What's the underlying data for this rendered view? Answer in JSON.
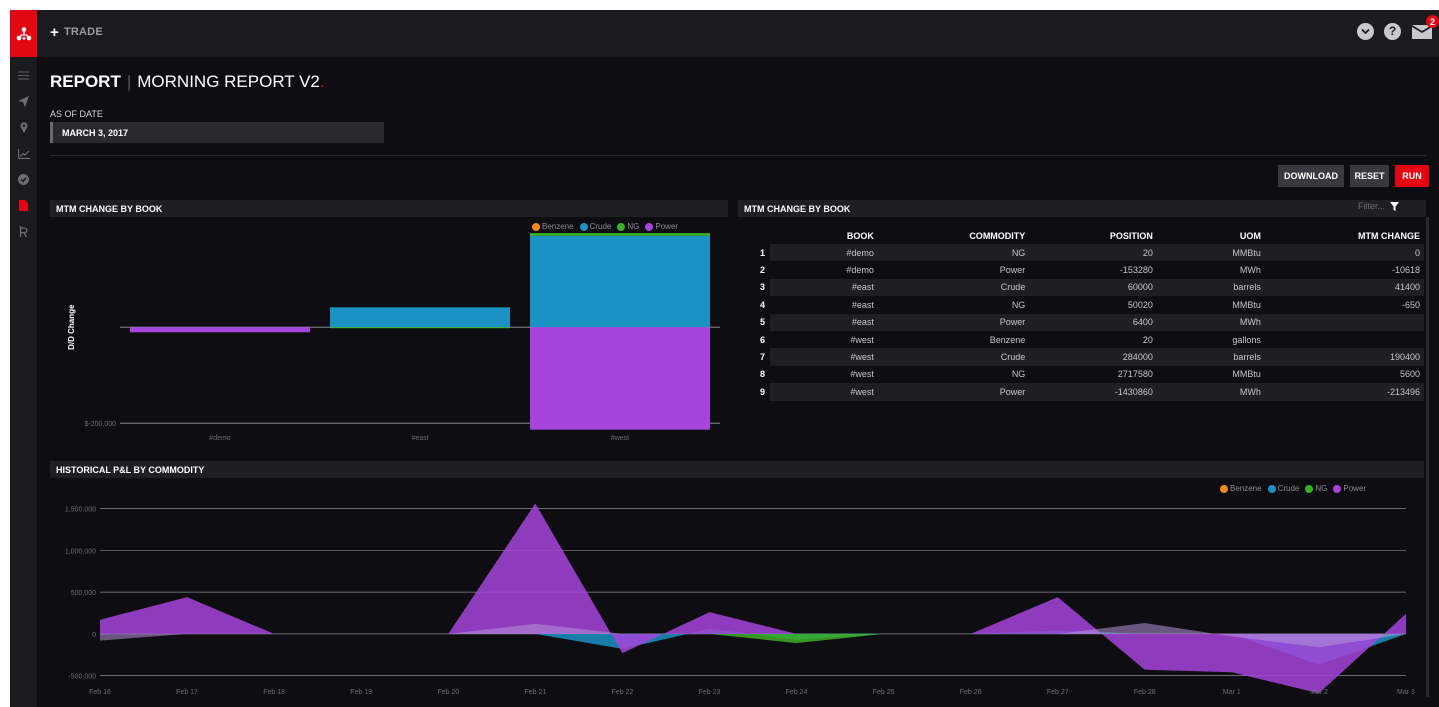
{
  "topbar": {
    "trade_label": "TRADE",
    "mail_count": "2"
  },
  "header": {
    "title_bold": "REPORT",
    "title_name": "MORNING REPORT V2",
    "title_dot": ".",
    "as_of_label": "AS OF DATE",
    "as_of_value": "MARCH 3, 2017"
  },
  "buttons": {
    "download": "DOWNLOAD",
    "reset": "RESET",
    "run": "RUN"
  },
  "panels": {
    "bar_title": "MTM CHANGE BY BOOK",
    "table_title": "MTM CHANGE BY BOOK",
    "history_title": "HISTORICAL P&L BY COMMODITY",
    "filter_placeholder": "Filter..."
  },
  "colors": {
    "Benzene": "#f28a1c",
    "Crude": "#1a93c4",
    "NG": "#3cb025",
    "Power": "#a644dc",
    "accent": "#e30613"
  },
  "table": {
    "columns": [
      "BOOK",
      "COMMODITY",
      "POSITION",
      "UOM",
      "MTM CHANGE"
    ],
    "rows": [
      {
        "idx": "1",
        "book": "#demo",
        "commodity": "NG",
        "position": "20",
        "uom": "MMBtu",
        "mtm": "0"
      },
      {
        "idx": "2",
        "book": "#demo",
        "commodity": "Power",
        "position": "-153280",
        "uom": "MWh",
        "mtm": "-10618"
      },
      {
        "idx": "3",
        "book": "#east",
        "commodity": "Crude",
        "position": "60000",
        "uom": "barrels",
        "mtm": "41400"
      },
      {
        "idx": "4",
        "book": "#east",
        "commodity": "NG",
        "position": "50020",
        "uom": "MMBtu",
        "mtm": "-650"
      },
      {
        "idx": "5",
        "book": "#east",
        "commodity": "Power",
        "position": "6400",
        "uom": "MWh",
        "mtm": ""
      },
      {
        "idx": "6",
        "book": "#west",
        "commodity": "Benzene",
        "position": "20",
        "uom": "gallons",
        "mtm": ""
      },
      {
        "idx": "7",
        "book": "#west",
        "commodity": "Crude",
        "position": "284000",
        "uom": "barrels",
        "mtm": "190400"
      },
      {
        "idx": "8",
        "book": "#west",
        "commodity": "NG",
        "position": "2717580",
        "uom": "MMBtu",
        "mtm": "5600"
      },
      {
        "idx": "9",
        "book": "#west",
        "commodity": "Power",
        "position": "-1430860",
        "uom": "MWh",
        "mtm": "-213496"
      }
    ]
  },
  "chart_data": [
    {
      "type": "bar",
      "stacked": true,
      "ylabel": "D/D Change",
      "tick_labels": [
        "$-200,000"
      ],
      "ylim": [
        -210000,
        190000
      ],
      "categories": [
        "#demo",
        "#east",
        "#west"
      ],
      "legend_position": "top-right",
      "series": [
        {
          "name": "Benzene",
          "values": [
            0,
            0,
            0
          ]
        },
        {
          "name": "Crude",
          "values": [
            0,
            41400,
            190400
          ]
        },
        {
          "name": "NG",
          "values": [
            0,
            -650,
            5600
          ]
        },
        {
          "name": "Power",
          "values": [
            -10618,
            0,
            -213496
          ]
        }
      ]
    },
    {
      "type": "area",
      "ylim": [
        -600000,
        1650000
      ],
      "y_ticks": [
        -500000,
        0,
        500000,
        1000000,
        1500000
      ],
      "y_tick_labels": [
        "-500,000",
        "0",
        "500,000",
        "1,000,000",
        "1,500,000"
      ],
      "x": [
        "Feb 16",
        "Feb 17",
        "Feb 18",
        "Feb 19",
        "Feb 20",
        "Feb 21",
        "Feb 22",
        "Feb 23",
        "Feb 24",
        "Feb 25",
        "Feb 26",
        "Feb 27",
        "Feb 28",
        "Mar 1",
        "Mar 2",
        "Mar 3"
      ],
      "legend_position": "top-right",
      "series": [
        {
          "name": "Benzene",
          "values": [
            0,
            0,
            0,
            0,
            0,
            0,
            0,
            0,
            0,
            0,
            0,
            0,
            0,
            0,
            0,
            0
          ]
        },
        {
          "name": "Crude",
          "values": [
            0,
            0,
            0,
            0,
            0,
            0,
            -180000,
            60000,
            -70000,
            0,
            0,
            40000,
            0,
            0,
            -370000,
            0
          ]
        },
        {
          "name": "NG",
          "values": [
            0,
            0,
            0,
            0,
            0,
            0,
            0,
            0,
            -110000,
            0,
            0,
            0,
            0,
            0,
            0,
            0
          ]
        },
        {
          "name": "Power",
          "values": [
            170000,
            440000,
            0,
            0,
            0,
            1560000,
            -230000,
            260000,
            0,
            0,
            0,
            440000,
            -430000,
            -460000,
            -710000,
            240000
          ]
        },
        {
          "name": "Power",
          "values": [
            -80000,
            0,
            0,
            0,
            0,
            120000,
            0,
            0,
            0,
            0,
            0,
            0,
            130000,
            -30000,
            -160000,
            0
          ]
        }
      ]
    }
  ]
}
